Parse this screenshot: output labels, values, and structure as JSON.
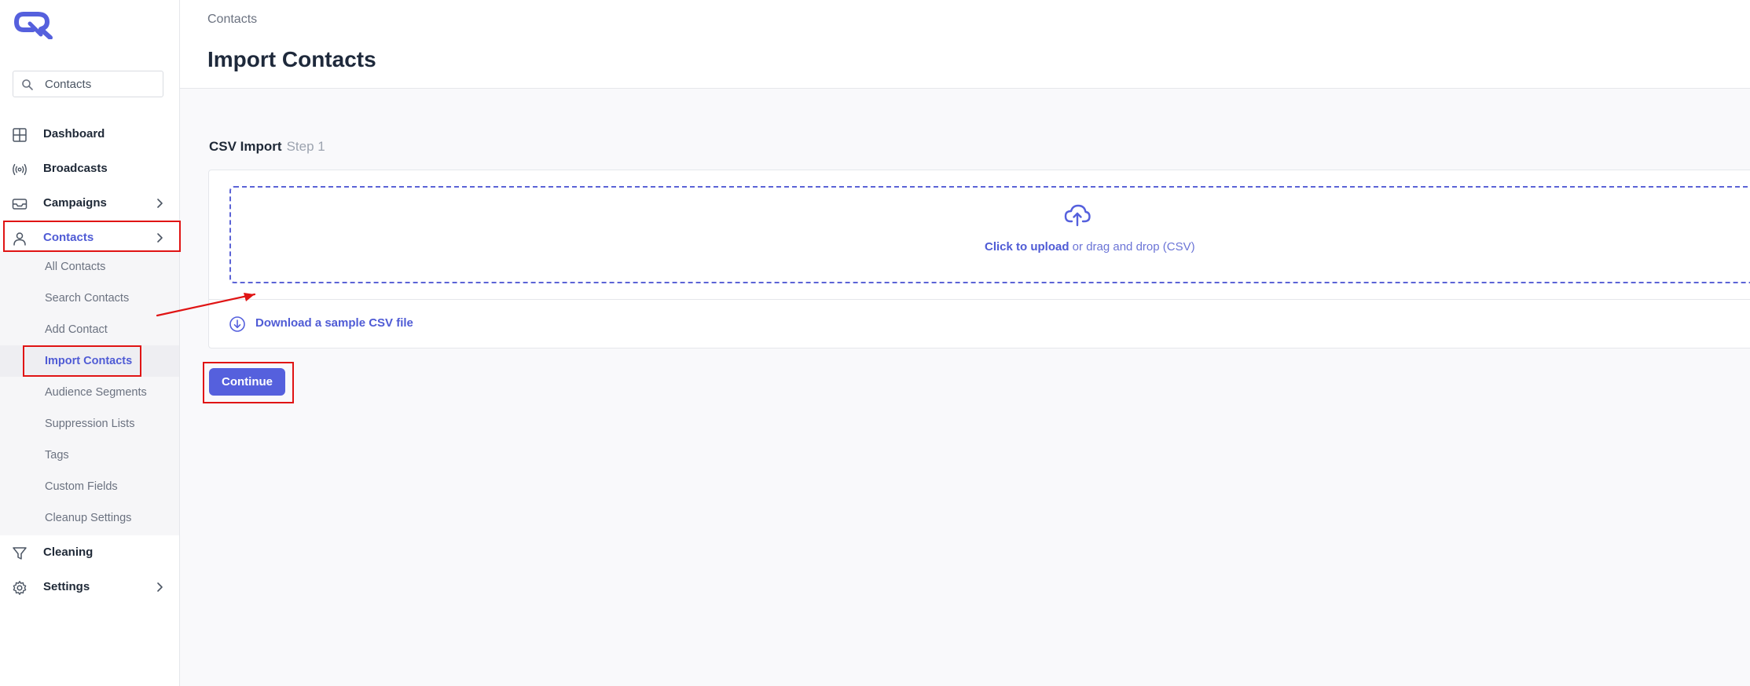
{
  "colors": {
    "accent": "#4f5bd5",
    "button_bg": "#5560dd",
    "dropzone_border": "#5b63d6",
    "annotation_red": "#e01414"
  },
  "sidebar": {
    "search_placeholder": "Contacts",
    "nav": [
      {
        "label": "Dashboard",
        "icon": "grid-icon"
      },
      {
        "label": "Broadcasts",
        "icon": "broadcast-icon"
      },
      {
        "label": "Campaigns",
        "icon": "inbox-icon"
      },
      {
        "label": "Contacts",
        "icon": "user-icon"
      },
      {
        "label": "Cleaning",
        "icon": "filter-icon"
      },
      {
        "label": "Settings",
        "icon": "gear-icon"
      }
    ],
    "submenu": [
      {
        "label": "All Contacts"
      },
      {
        "label": "Search Contacts"
      },
      {
        "label": "Add Contact"
      },
      {
        "label": "Import Contacts"
      },
      {
        "label": "Audience Segments"
      },
      {
        "label": "Suppression Lists"
      },
      {
        "label": "Tags"
      },
      {
        "label": "Custom Fields"
      },
      {
        "label": "Cleanup Settings"
      }
    ]
  },
  "header": {
    "breadcrumb": "Contacts",
    "title": "Import Contacts"
  },
  "import": {
    "section_title": "CSV Import",
    "step": "Step 1",
    "upload_strong": "Click to upload",
    "upload_rest": " or drag and drop (CSV)",
    "download_label": "Download a sample CSV file",
    "continue_label": "Continue"
  }
}
